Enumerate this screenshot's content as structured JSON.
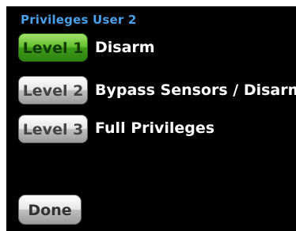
{
  "screen": {
    "title": "Privileges User 2",
    "title_color": "#4aa0e8",
    "background_color": "#000000"
  },
  "levels": [
    {
      "button_label": "Level 1",
      "description": "Disarm",
      "state": "selected",
      "color": "#5fbf2b"
    },
    {
      "button_label": "Level 2",
      "description": "Bypass Sensors / Disarm",
      "state": "unselected",
      "color": "#d9d9d9"
    },
    {
      "button_label": "Level 3",
      "description": "Full Privileges",
      "state": "unselected",
      "color": "#d9d9d9"
    }
  ],
  "footer": {
    "done_label": "Done"
  }
}
